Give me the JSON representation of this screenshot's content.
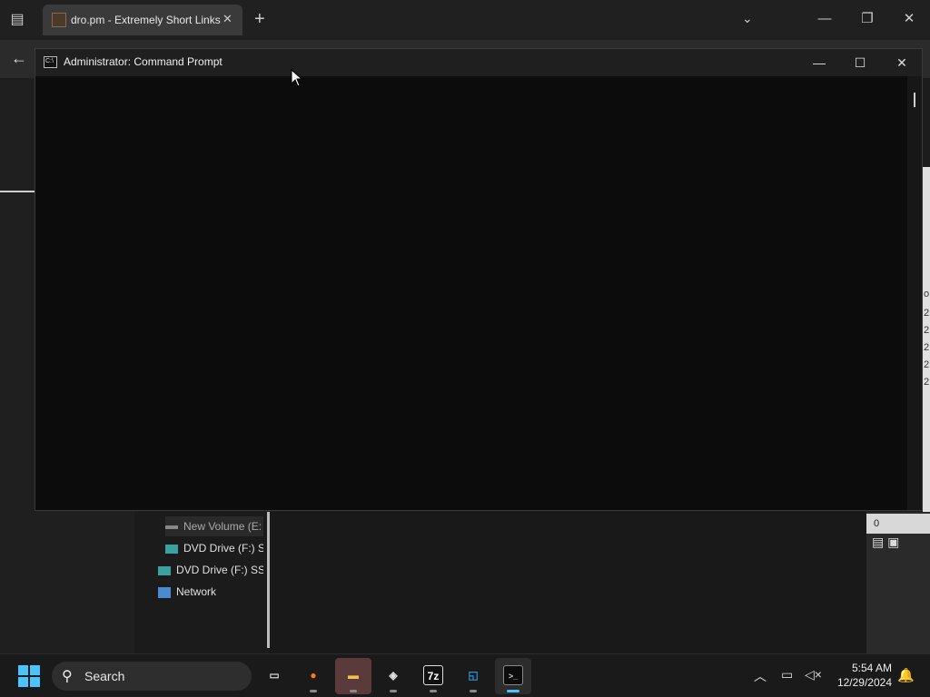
{
  "browser": {
    "tab_title": "dro.pm - Extremely Short Links",
    "tab_close": "✕",
    "new_tab": "+",
    "tab_list": "⌄",
    "tab_actions": "▤",
    "back": "←",
    "window_controls": {
      "minimize": "—",
      "restore": "❐",
      "close": "✕"
    }
  },
  "cmd": {
    "title": "Administrator: Command Prompt",
    "icon_text": "C:\\",
    "controls": {
      "minimize": "—",
      "maximize": "☐",
      "close": "✕"
    }
  },
  "explorer": {
    "nav_items": [
      {
        "label": "New Volume (E:",
        "icon": "drive-icon"
      },
      {
        "label": "DVD Drive (F:) S",
        "icon": "dvd-icon"
      },
      {
        "label": "DVD Drive (F:) SSS",
        "icon": "dvd-icon"
      },
      {
        "label": "Network",
        "icon": "network-icon"
      }
    ],
    "status_count": "0",
    "right_labels": [
      "o",
      "2",
      "2",
      "2",
      "2",
      "2"
    ]
  },
  "taskbar": {
    "search_label": "Search",
    "clock_time": "5:54 AM",
    "clock_date": "12/29/2024",
    "apps": [
      {
        "name": "task-view",
        "glyph": "▭",
        "color": "#d0d0d0"
      },
      {
        "name": "firefox",
        "glyph": "●",
        "color": "#ff7a1a"
      },
      {
        "name": "file-explorer",
        "glyph": "▬",
        "color": "#f2c14e"
      },
      {
        "name": "installer",
        "glyph": "◈",
        "color": "#e0e0e0"
      },
      {
        "name": "7zip",
        "glyph": "7z",
        "color": "#ffffff"
      },
      {
        "name": "virtualbox",
        "glyph": "◱",
        "color": "#2f8fd6"
      },
      {
        "name": "command-prompt",
        "glyph": ">_",
        "color": "#cccccc"
      }
    ]
  }
}
